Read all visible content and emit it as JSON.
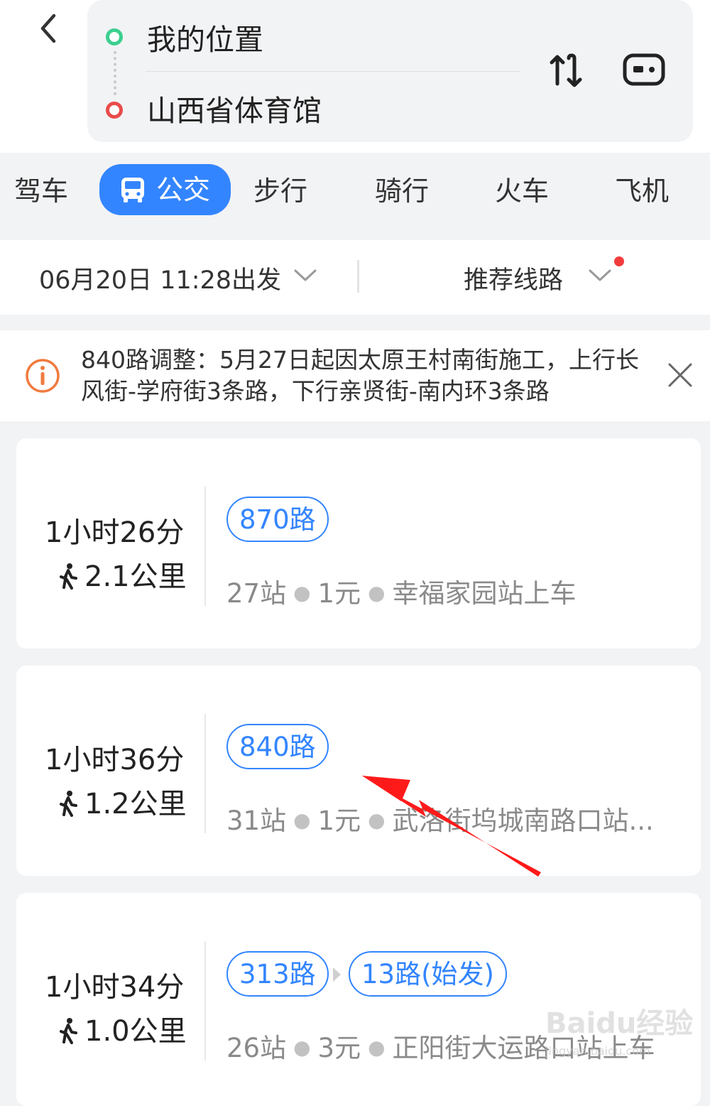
{
  "header": {
    "start": "我的位置",
    "end": "山西省体育馆",
    "icons": {
      "back": "back-arrow-icon",
      "swap": "swap-icon",
      "more": "more-options-icon"
    }
  },
  "tabs": [
    {
      "label": "驾车"
    },
    {
      "label": "公交",
      "active": true
    },
    {
      "label": "步行"
    },
    {
      "label": "骑行"
    },
    {
      "label": "火车"
    },
    {
      "label": "飞机"
    }
  ],
  "filter": {
    "departure": "06月20日 11:28出发",
    "strategy": "推荐线路"
  },
  "notice": {
    "text": "840路调整：5月27日起因太原王村南街施工，上行长风街-学府街3条路，下行亲贤街-南内环3条路"
  },
  "routes": [
    {
      "duration": "1小时26分",
      "walk": "2.1公里",
      "lines": [
        "870路"
      ],
      "stops": "27站",
      "fare": "1元",
      "board": "幸福家园站上车"
    },
    {
      "duration": "1小时36分",
      "walk": "1.2公里",
      "lines": [
        "840路"
      ],
      "stops": "31站",
      "fare": "1元",
      "board": "武洛街坞城南路口站..."
    },
    {
      "duration": "1小时34分",
      "walk": "1.0公里",
      "lines": [
        "313路",
        "13路(始发)"
      ],
      "stops": "26站",
      "fare": "3元",
      "board": "正阳街大运路口站上车"
    }
  ],
  "watermark": {
    "brand": "Baidu经验",
    "url": "jingyan.baidu.com"
  },
  "colors": {
    "accent": "#3385ff",
    "start_dot": "#3ccf8e",
    "end_dot": "#ea4b4b",
    "annotation": "#ff1a1a"
  }
}
